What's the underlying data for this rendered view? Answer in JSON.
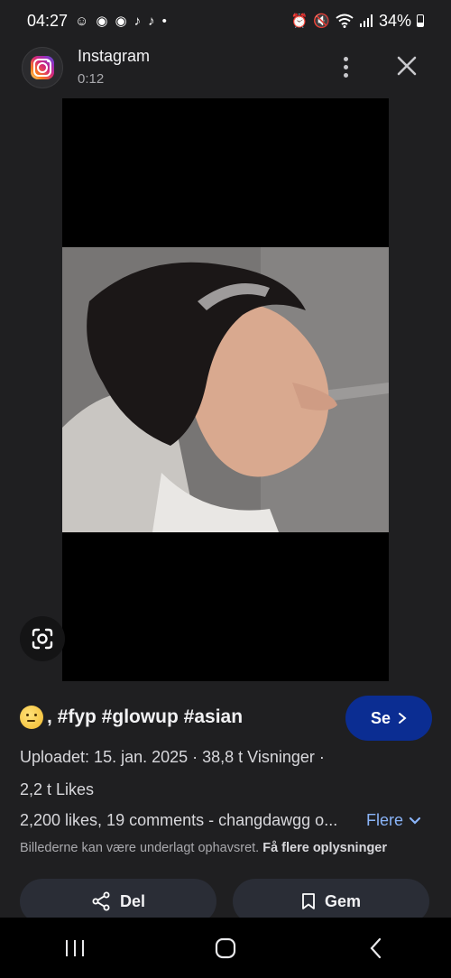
{
  "status_bar": {
    "time": "04:27",
    "notification_icons": [
      "snapchat-icon",
      "chat-icon",
      "discord-icon",
      "tiktok-icon",
      "tiktok-icon"
    ],
    "dot": "•",
    "battery": "34%"
  },
  "header": {
    "app_name": "Instagram",
    "duration": "0:12"
  },
  "post": {
    "caption": ", #fyp #glowup #asian",
    "visit_label": "Se",
    "upload_line": "Uploadet: 15. jan. 2025  ·  38,8 t Visninger  ·",
    "likes_line": "2,2 t Likes",
    "description": "2,200 likes, 19 comments - changdawgg o...",
    "more_label": "Flere",
    "copyright_text": "Billederne kan være underlagt ophavsret.",
    "copyright_link": "Få flere oplysninger"
  },
  "actions": {
    "share_label": "Del",
    "save_label": "Gem"
  },
  "colors": {
    "background": "#1f1f21",
    "accent_button": "#0b2d92",
    "link": "#8ab4f8"
  }
}
